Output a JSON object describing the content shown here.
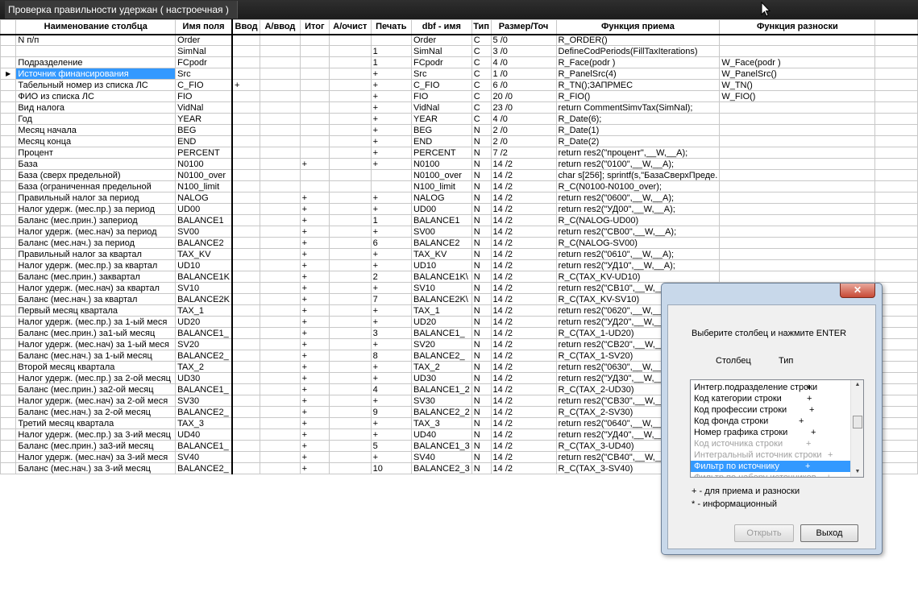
{
  "window": {
    "title": "Проверка правильности удержан ( настроечная )"
  },
  "grid": {
    "columns": [
      "Наименование столбца",
      "Имя поля",
      "Ввод",
      "А/ввод",
      "Итог",
      "А/очист",
      "Печать",
      "dbf - имя",
      "Тип",
      "Размер/Точ",
      "Функция приема",
      "Функция разноски"
    ],
    "rows": [
      [
        "N п/п",
        "Order",
        "",
        "",
        "",
        "",
        "",
        "Order",
        "C",
        "5    /0",
        "R_ORDER()",
        ""
      ],
      [
        "",
        "SimNal",
        "",
        "",
        "",
        "",
        "1",
        "SimNal",
        "C",
        "3    /0",
        "DefineCodPeriods(FillTaxIterations)",
        ""
      ],
      [
        "Подразделение",
        "FCpodr",
        "",
        "",
        "",
        "",
        "1",
        "FCpodr",
        "C",
        "4    /0",
        "R_Face(podr              )",
        "W_Face(podr               )"
      ],
      [
        "Источник финансирования",
        "Src",
        "",
        "",
        "",
        "",
        "+",
        "Src",
        "C",
        "1    /0",
        "R_PanelSrc(4)",
        "W_PanelSrc()"
      ],
      [
        "Табельный  номер из   списка ЛС",
        "C_FIO",
        "+",
        "",
        "",
        "",
        "+",
        "C_FIO",
        "C",
        "6    /0",
        "R_TN();ЗАПРМЕС",
        "W_TN()"
      ],
      [
        "ФИО из списка ЛС",
        "FIO",
        "",
        "",
        "",
        "",
        "+",
        "FIO",
        "C",
        "20   /0",
        "R_FIO()",
        "W_FIO()"
      ],
      [
        "Вид налога",
        "VidNal",
        "",
        "",
        "",
        "",
        "+",
        "VidNal",
        "C",
        "23   /0",
        "return CommentSimvTax(SimNal);",
        ""
      ],
      [
        "Год",
        "YEAR",
        "",
        "",
        "",
        "",
        "+",
        "YEAR",
        "C",
        "4    /0",
        "R_Date(6);",
        ""
      ],
      [
        "Месяц     начала",
        "BEG",
        "",
        "",
        "",
        "",
        "+",
        "BEG",
        "N",
        "2    /0",
        "R_Date(1)",
        ""
      ],
      [
        "Месяц     конца",
        "END",
        "",
        "",
        "",
        "",
        "+",
        "END",
        "N",
        "2    /0",
        "R_Date(2)",
        ""
      ],
      [
        "Процент",
        "PERCENT",
        "",
        "",
        "",
        "",
        "+",
        "PERCENT",
        "N",
        "7    /2",
        "return res2(\"процент\",__W,__A);",
        ""
      ],
      [
        "База",
        "N0100",
        "",
        "",
        "+",
        "",
        "+",
        "N0100",
        "N",
        "14   /2",
        "return res2(\"0100\",__W,__A);",
        ""
      ],
      [
        "База (сверх   предельной)",
        "N0100_over",
        "",
        "",
        "",
        "",
        "",
        "N0100_over",
        "N",
        "14   /2",
        "char s[256]; sprintf(s,\"БазаСверхПреде.",
        ""
      ],
      [
        "База        (ограниченная предельной",
        "N100_limit",
        "",
        "",
        "",
        "",
        "",
        "N100_limit",
        "N",
        "14   /2",
        "R_C(N0100-N0100_over);",
        ""
      ],
      [
        "Правильный   налог за    период",
        "NALOG",
        "",
        "",
        "+",
        "",
        "+",
        "NALOG",
        "N",
        "14   /2",
        "return res2(\"0600\",__W,__A);",
        ""
      ],
      [
        "Налог удерж. (мес.пр.) за период",
        "UD00",
        "",
        "",
        "+",
        "",
        "+",
        "UD00",
        "N",
        "14   /2",
        "return res2(\"УД00\",__W,__A);",
        ""
      ],
      [
        "Баланс     (мес.прин.) запериод",
        "BALANCE1",
        "",
        "",
        "+",
        "",
        "1",
        "BALANCE1",
        "N",
        "14   /2",
        "R_C(NALOG-UD00)",
        ""
      ],
      [
        "Налог удерж. (мес.нач) за период",
        "SV00",
        "",
        "",
        "+",
        "",
        "+",
        "SV00",
        "N",
        "14   /2",
        "return res2(\"СВ00\",__W,__A);",
        ""
      ],
      [
        "Баланс     (мес.нач.) за период",
        "BALANCE2",
        "",
        "",
        "+",
        "",
        "6",
        "BALANCE2",
        "N",
        "14   /2",
        "R_C(NALOG-SV00)",
        ""
      ],
      [
        "Правильный   налог за     квартал",
        "TAX_KV",
        "",
        "",
        "+",
        "",
        "+",
        "TAX_KV",
        "N",
        "14   /2",
        "return res2(\"0610\",__W,__A);",
        ""
      ],
      [
        "Налог удерж. (мес.пр.) за квартал",
        "UD10",
        "",
        "",
        "+",
        "",
        "+",
        "UD10",
        "N",
        "14   /2",
        "return res2(\"УД10\",__W,__A);",
        ""
      ],
      [
        "Баланс     (мес.прин.) заквартал",
        "BALANCE1K",
        "",
        "",
        "+",
        "",
        "2",
        "BALANCE1K\\",
        "N",
        "14   /2",
        "R_C(TAX_KV-UD10)",
        ""
      ],
      [
        "Налог удерж. (мес.нач) за квартал",
        "SV10",
        "",
        "",
        "+",
        "",
        "+",
        "SV10",
        "N",
        "14   /2",
        "return res2(\"СВ10\",__W,__A);",
        ""
      ],
      [
        "Баланс     (мес.нач.) за квартал",
        "BALANCE2K",
        "",
        "",
        "+",
        "",
        "7",
        "BALANCE2K\\",
        "N",
        "14   /2",
        "R_C(TAX_KV-SV10)",
        ""
      ],
      [
        "Первый месяц  квартала",
        "TAX_1",
        "",
        "",
        "+",
        "",
        "+",
        "TAX_1",
        "N",
        "14   /2",
        "return res2(\"0620\",__W,__A);",
        ""
      ],
      [
        "Налог удерж.  (мес.пр.) за  1-ый меся",
        "UD20",
        "",
        "",
        "+",
        "",
        "+",
        "UD20",
        "N",
        "14   /2",
        "return res2(\"УД20\",__W,__A);",
        ""
      ],
      [
        "Баланс     (мес.прин.) за1-ый месяц",
        "BALANCE1_",
        "",
        "",
        "+",
        "",
        "3",
        "BALANCE1_",
        "N",
        "14   /2",
        "R_C(TAX_1-UD20)",
        ""
      ],
      [
        "Налог удерж. (мес.нач) за  1-ый меся",
        "SV20",
        "",
        "",
        "+",
        "",
        "+",
        "SV20",
        "N",
        "14   /2",
        "return res2(\"СВ20\",__W,__A);",
        ""
      ],
      [
        "Баланс      (мес.нач.) за 1-ый месяц",
        "BALANCE2_",
        "",
        "",
        "+",
        "",
        "8",
        "BALANCE2_",
        "N",
        "14   /2",
        "R_C(TAX_1-SV20)",
        ""
      ],
      [
        "Второй месяц  квартала",
        "TAX_2",
        "",
        "",
        "+",
        "",
        "+",
        "TAX_2",
        "N",
        "14   /2",
        "return res2(\"0630\",__W,__A);",
        ""
      ],
      [
        "Налог удерж.  (мес.пр.) за  2-ой месяц",
        "UD30",
        "",
        "",
        "+",
        "",
        "+",
        "UD30",
        "N",
        "14   /2",
        "return res2(\"УД30\",__W,__A);",
        ""
      ],
      [
        "Баланс     (мес.прин.) за2-ой месяц",
        "BALANCE1_",
        "",
        "",
        "+",
        "",
        "4",
        "BALANCE1_2",
        "N",
        "14   /2",
        "R_C(TAX_2-UD30)",
        ""
      ],
      [
        "Налог удерж.  (мес.нач) за  2-ой меся",
        "SV30",
        "",
        "",
        "+",
        "",
        "+",
        "SV30",
        "N",
        "14   /2",
        "return res2(\"СВ30\",__W,__A);",
        ""
      ],
      [
        "Баланс     (мес.нач.) за 2-ой месяц",
        "BALANCE2_",
        "",
        "",
        "+",
        "",
        "9",
        "BALANCE2_2",
        "N",
        "14   /2",
        "R_C(TAX_2-SV30)",
        ""
      ],
      [
        "Третий месяц  квартала",
        "TAX_3",
        "",
        "",
        "+",
        "",
        "+",
        "TAX_3",
        "N",
        "14   /2",
        "return res2(\"0640\",__W,__A);",
        ""
      ],
      [
        "Налог удерж.  (мес.пр.) за  3-ий месяц",
        "UD40",
        "",
        "",
        "+",
        "",
        "+",
        "UD40",
        "N",
        "14   /2",
        "return res2(\"УД40\",__W,__A);",
        ""
      ],
      [
        "Баланс     (мес.прин.) за3-ий месяц",
        "BALANCE1_",
        "",
        "",
        "+",
        "",
        "5",
        "BALANCE1_3",
        "N",
        "14   /2",
        "R_C(TAX_3-UD40)",
        ""
      ],
      [
        "Налог удерж.  (мес.нач) за  3-ий меся",
        "SV40",
        "",
        "",
        "+",
        "",
        "+",
        "SV40",
        "N",
        "14   /2",
        "return res2(\"СВ40\",__W,__A);",
        ""
      ],
      [
        "Баланс     (мес.нач.) за 3-ий месяц",
        "BALANCE2_",
        "",
        "",
        "+",
        "",
        "10",
        "BALANCE2_3",
        "N",
        "14   /2",
        "R_C(TAX_3-SV40)",
        ""
      ]
    ],
    "selected_row": 3,
    "selection_color": "#3399ff"
  },
  "dialog": {
    "close_label": "✕",
    "prompt": "Выберите столбец и нажмите ENTER",
    "col_header": "Столбец",
    "type_header": "Тип",
    "items": [
      {
        "label": "Интегр.подразделение строки",
        "mark": "+",
        "dim": false,
        "selected": false
      },
      {
        "label": "Код категории строки",
        "mark": "+",
        "dim": false,
        "selected": false
      },
      {
        "label": "Код профессии строки",
        "mark": "+",
        "dim": false,
        "selected": false
      },
      {
        "label": "Код фонда строки",
        "mark": "+",
        "dim": false,
        "selected": false
      },
      {
        "label": "Номер графика строки",
        "mark": "+",
        "dim": false,
        "selected": false
      },
      {
        "label": "Код источника строки",
        "mark": "+",
        "dim": true,
        "selected": false
      },
      {
        "label": "Интегральный источник строки",
        "mark": "+",
        "dim": true,
        "selected": false
      },
      {
        "label": "Фильтр по источнику",
        "mark": "+",
        "dim": false,
        "selected": true
      },
      {
        "label": "Фильтр по набору источников",
        "mark": "+",
        "dim": true,
        "selected": false
      }
    ],
    "legend1": "+ - для приема и разноски",
    "legend2": "* - информационный",
    "open_label": "Открыть",
    "exit_label": "Выход"
  }
}
